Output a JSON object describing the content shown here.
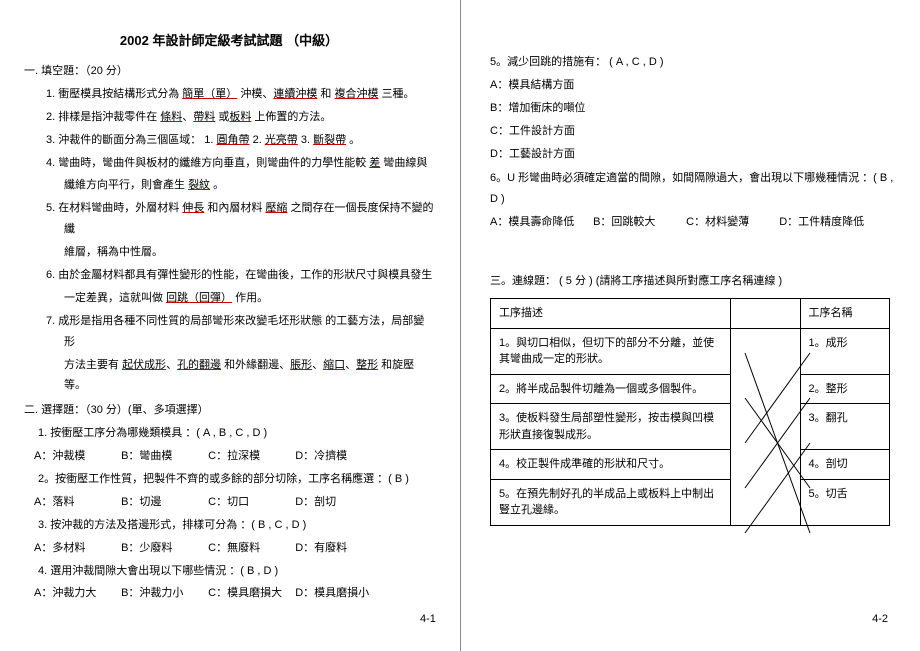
{
  "title": "2002 年設計師定級考試試題  （中級）",
  "sec1_head": "一. 填空題：（20 分）",
  "f1_prefix": "1.    衝壓模具按結構形式分為 ",
  "f1_b1": "簡單（單）",
  "f1_mid1": " 沖模、",
  "f1_b2": "連續沖模",
  "f1_mid2": " 和 ",
  "f1_b3": "複合沖模",
  "f1_suffix": " 三種。",
  "f2_prefix": "2.    排樣是指沖裁零件在 ",
  "f2_b1": "條料",
  "f2_s1": "、",
  "f2_b2": "帶料",
  "f2_s2": " 或",
  "f2_b3": "板料",
  "f2_suffix": " 上佈置的方法。",
  "f3_prefix": "3.    沖裁件的斷面分為三個區域：  1. ",
  "f3_b1": "圓角帶",
  "f3_s1": " 2. ",
  "f3_b2": "光亮帶",
  "f3_s2": " 3. ",
  "f3_b3": "斷裂帶",
  "f3_suffix": " 。",
  "f4_prefix": "4.    彎曲時，彎曲件與板材的纖維方向垂直，則彎曲件的力學性能較     ",
  "f4_b1": "差",
  "f4_mid": " 彎曲線與",
  "f4_line2a": "纖維方向平行，則會產生 ",
  "f4_b2": "裂紋",
  "f4_suffix": " 。",
  "f5_prefix": "5.    在材料彎曲時，外層材料 ",
  "f5_b1": "伸長",
  "f5_mid": " 和內層材料 ",
  "f5_b2": "壓縮",
  "f5_end": " 之間存在一個長度保持不變的纖",
  "f5_line2": "維層，稱為中性層。",
  "f6_prefix": "6.    由於金屬材料都具有彈性變形的性能，在彎曲後，工作的形狀尺寸與模具發生",
  "f6_line2a": "一定差異，這就叫做 ",
  "f6_b1": "回跳（回彈）",
  "f6_suffix": " 作用。",
  "f7_prefix": "7.    成形是指用各種不同性質的局部彎形來改變毛坯形狀態     的工藝方法，局部變形",
  "f7_line2a": "方法主要有 ",
  "f7_b1": "起伏成形",
  "f7_s1": "、",
  "f7_b2": "孔的翻邊",
  "f7_s2": " 和外緣翻邊、",
  "f7_b3": "脹形",
  "f7_s3": "、",
  "f7_b4": "縮口",
  "f7_s4": "、",
  "f7_b5": "整形",
  "f7_suffix": " 和旋壓等。",
  "sec2_head": "二. 選擇題：（30 分）(單、多項選擇）",
  "q2_1": "1.    按衝壓工序分為哪幾類模具  ：( A , B , C , D )",
  "q2_1_opts": {
    "A": "A：沖裁模",
    "B": "B：彎曲模",
    "C": "C：拉深模",
    "D": "D：冷擠模"
  },
  "q2_2": "2。按衝壓工作性質，把製件不齊的或多餘的部分切除，工序名稱應選    ：( B )",
  "q2_2_opts": {
    "A": "A：落料",
    "B": "B：切邊",
    "C": "C：切口",
    "D": "D：剖切"
  },
  "q2_3": "3.    按沖裁的方法及搭邊形式，排樣可分為  ：( B , C , D )",
  "q2_3_opts": {
    "A": "A：多材料",
    "B": "B：少廢料",
    "C": "C：無廢料",
    "D": "D：有廢料"
  },
  "q2_4": "4.    選用沖裁間隙大會出現以下哪些情況  ：( B , D )",
  "q2_4_opts": {
    "A": "A：沖裁力大",
    "B": "B：沖裁力小",
    "C": "C：模具磨損大",
    "D": "D：模具磨損小"
  },
  "right5": "5。減少回跳的措施有：  ( A ,  C ,  D )",
  "right5_opts": {
    "A": "A：模具結構方面",
    "B": "B：增加衝床的噸位",
    "C": "C：工件設計方面",
    "D": "D：工藝設計方面"
  },
  "right6_a": "6。U 形彎曲時必須確定適當的間隙，如間隔隙過大，會出現以下哪幾種情況    ：( B , D )",
  "right6_opts": {
    "A": "A：模具壽命降低",
    "B": "B：回跳較大",
    "C": "C：材料變薄",
    "D": "D：工件精度降低"
  },
  "sec3_head": "三。連線題：  ( 5 分 ) (請將工序描述與所對應工序名稱連線   )",
  "th1": "工序描述",
  "th2": "工序名稱",
  "desc1": "1。與切口相似，但切下的部分不分離，並使其彎曲成一定的形狀。",
  "desc2": "2。將半成品製件切離為一個或多個製件。",
  "desc3": "3。使板料發生局部塑性變形，按击模與凹模形狀直接復製成形。",
  "desc4": "4。校正製件成準確的形狀和尺寸。",
  "desc5": "5。在預先制好孔的半成品上或板料上中制出豎立孔邊緣。",
  "name1": "1。成形",
  "name2": "2。整形",
  "name3": "3。翻孔",
  "name4": "4。剖切",
  "name5": "5。切舌",
  "pg_l": "4-1",
  "pg_r": "4-2",
  "lines_stroke": "#000"
}
